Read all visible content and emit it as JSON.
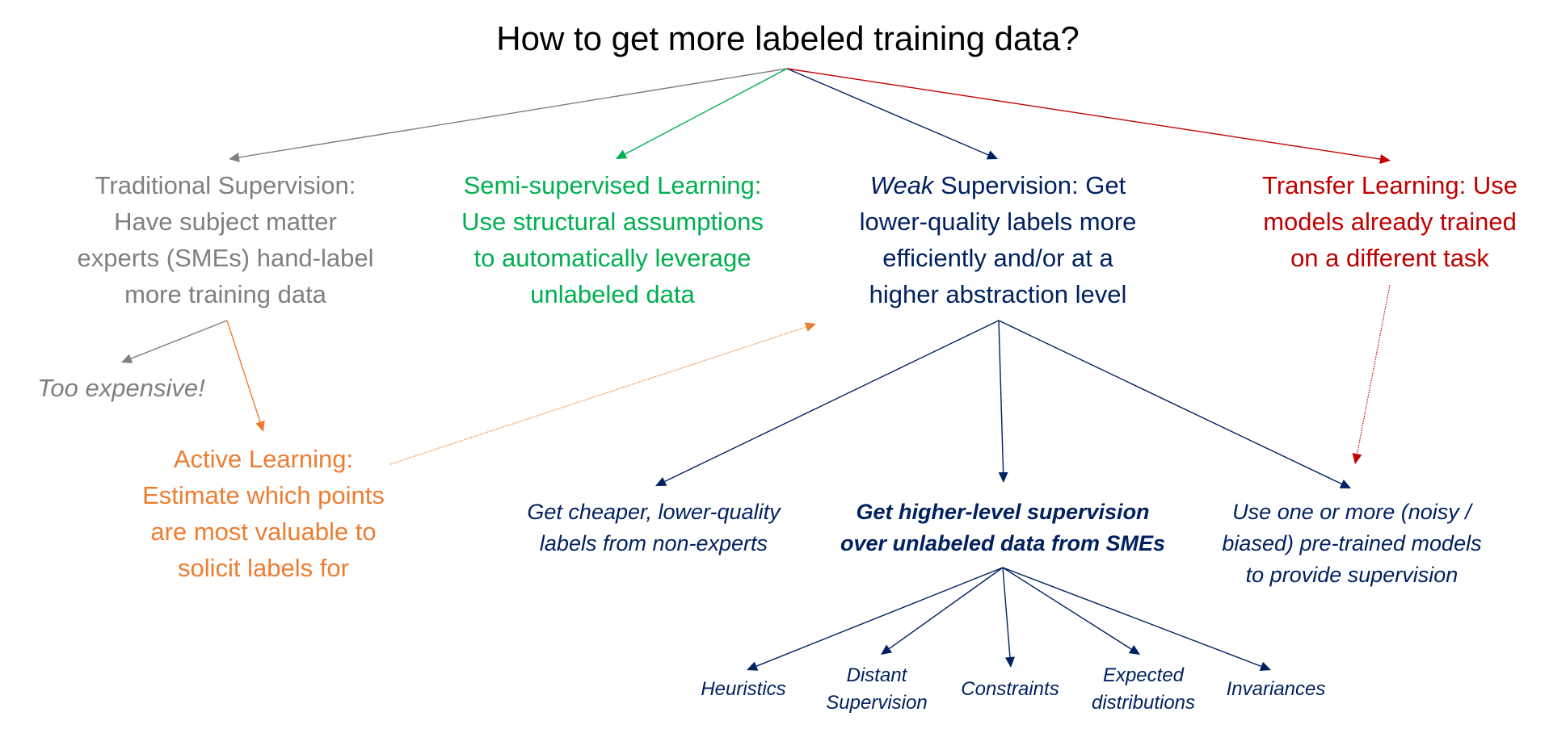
{
  "title": "How to get more labeled training data?",
  "colors": {
    "traditional": "#7f7f7f",
    "semi": "#00b050",
    "weak": "#002060",
    "transfer": "#c00000",
    "active": "#ed7d31"
  },
  "nodes": {
    "traditional": {
      "heading": "Traditional Supervision:",
      "lines": [
        "Have subject matter",
        "experts (SMEs) hand-label",
        "more training data"
      ]
    },
    "semi": {
      "heading": "Semi-supervised Learning:",
      "lines": [
        "Use structural assumptions",
        "to automatically leverage",
        "unlabeled data"
      ]
    },
    "weak": {
      "heading_italic": "Weak",
      "heading_rest": " Supervision:",
      "heading_tail": " Get",
      "lines": [
        "lower-quality labels more",
        "efficiently and/or at a",
        "higher abstraction level"
      ]
    },
    "transfer": {
      "heading": "Transfer Learning:",
      "heading_tail": " Use",
      "lines": [
        "models already trained",
        "on a different task"
      ]
    },
    "too_expensive": "Too expensive!",
    "active": {
      "heading": "Active Learning:",
      "lines": [
        "Estimate which points",
        "are most valuable to",
        "solicit labels for"
      ]
    },
    "weak_children": [
      {
        "lines": [
          "Get cheaper, lower-quality",
          "labels from non-experts"
        ],
        "bold": false
      },
      {
        "lines": [
          "Get higher-level supervision",
          "over unlabeled data from SMEs"
        ],
        "bold": true
      },
      {
        "lines": [
          "Use one or more (noisy /",
          "biased) pre-trained models",
          "to provide supervision"
        ],
        "bold": false
      }
    ],
    "sme_children": [
      {
        "lines": [
          "Heuristics"
        ]
      },
      {
        "lines": [
          "Distant",
          "Supervision"
        ]
      },
      {
        "lines": [
          "Constraints"
        ]
      },
      {
        "lines": [
          "Expected",
          "distributions"
        ]
      },
      {
        "lines": [
          "Invariances"
        ]
      }
    ]
  },
  "edges": [
    {
      "from": "title",
      "to": "traditional",
      "color": "traditional",
      "style": "solid"
    },
    {
      "from": "title",
      "to": "semi",
      "color": "semi",
      "style": "solid"
    },
    {
      "from": "title",
      "to": "weak",
      "color": "weak",
      "style": "solid"
    },
    {
      "from": "title",
      "to": "transfer",
      "color": "transfer",
      "style": "solid"
    },
    {
      "from": "traditional",
      "to": "too_expensive",
      "color": "traditional",
      "style": "solid"
    },
    {
      "from": "traditional",
      "to": "active",
      "color": "active",
      "style": "solid"
    },
    {
      "from": "active",
      "to": "weak",
      "color": "active",
      "style": "dotted"
    },
    {
      "from": "weak",
      "to": "weak_child_0",
      "color": "weak",
      "style": "solid"
    },
    {
      "from": "weak",
      "to": "weak_child_1",
      "color": "weak",
      "style": "solid"
    },
    {
      "from": "weak",
      "to": "weak_child_2",
      "color": "weak",
      "style": "solid"
    },
    {
      "from": "transfer",
      "to": "weak_child_2",
      "color": "transfer",
      "style": "dotted"
    },
    {
      "from": "weak_child_1",
      "to": "sme_child_0",
      "color": "weak",
      "style": "solid"
    },
    {
      "from": "weak_child_1",
      "to": "sme_child_1",
      "color": "weak",
      "style": "solid"
    },
    {
      "from": "weak_child_1",
      "to": "sme_child_2",
      "color": "weak",
      "style": "solid"
    },
    {
      "from": "weak_child_1",
      "to": "sme_child_3",
      "color": "weak",
      "style": "solid"
    },
    {
      "from": "weak_child_1",
      "to": "sme_child_4",
      "color": "weak",
      "style": "solid"
    }
  ]
}
